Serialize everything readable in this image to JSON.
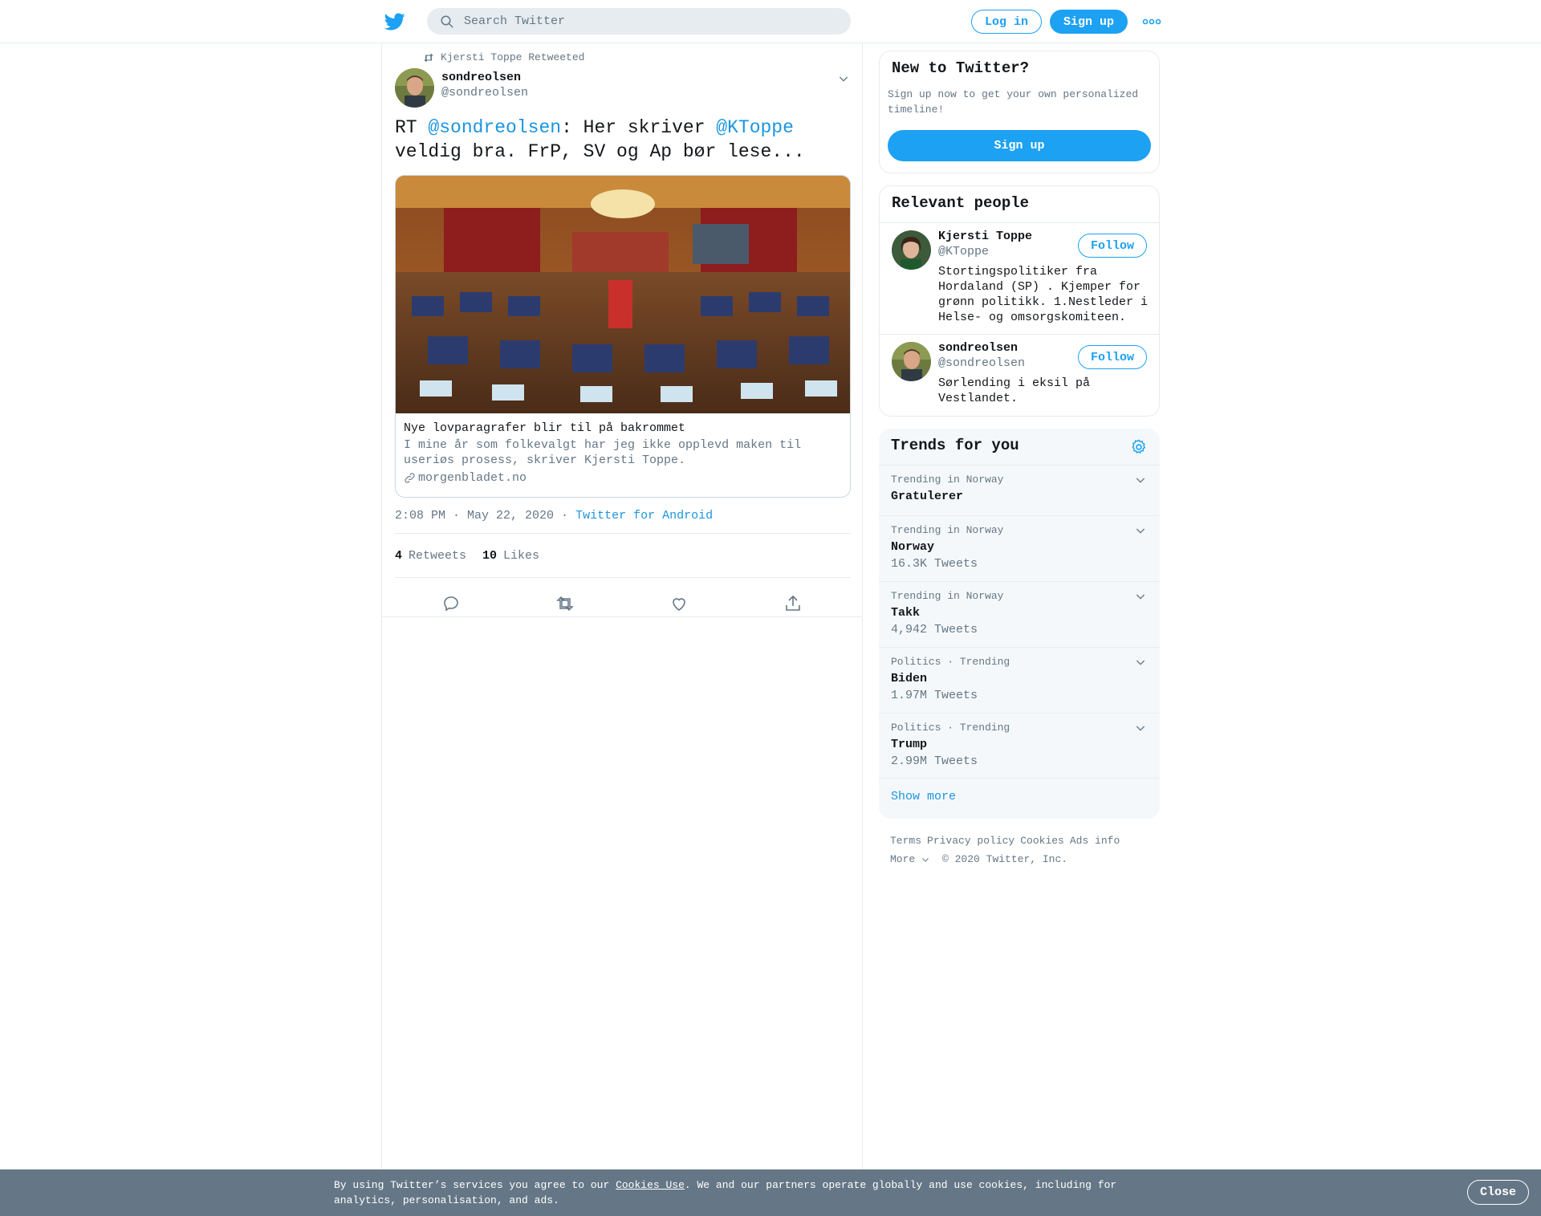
{
  "header": {
    "search_placeholder": "Search Twitter",
    "login_label": "Log in",
    "signup_label": "Sign up"
  },
  "tweet": {
    "retweeted_by": "Kjersti Toppe Retweeted",
    "author_name": "sondreolsen",
    "author_handle": "@sondreolsen",
    "text_prefix": "RT ",
    "mention1": "@sondreolsen",
    "text_mid": ": Her skriver ",
    "mention2": "@KToppe",
    "text_suffix": " veldig bra. FrP, SV og Ap bør lese...",
    "card": {
      "title": "Nye lovparagrafer blir til på bakrommet",
      "description": "I mine år som folkevalgt har jeg ikke opplevd maken til useriøs prosess, skriver Kjersti Toppe.",
      "domain": "morgenbladet.no"
    },
    "time": "2:08 PM · May 22, 2020",
    "separator": " · ",
    "source": "Twitter for Android",
    "retweets_count": "4",
    "retweets_label": "Retweets",
    "likes_count": "10",
    "likes_label": "Likes"
  },
  "sidebar": {
    "new_title": "New to Twitter?",
    "new_desc": "Sign up now to get your own personalized timeline!",
    "new_signup": "Sign up",
    "people_title": "Relevant people",
    "people": [
      {
        "name": "Kjersti Toppe",
        "handle": "@KToppe",
        "bio": "Stortingspolitiker fra Hordaland (SP) . Kjemper for grønn politikk. 1.Nestleder i Helse- og omsorgskomiteen.",
        "follow": "Follow"
      },
      {
        "name": "sondreolsen",
        "handle": "@sondreolsen",
        "bio": "Sørlending i eksil på Vestlandet.",
        "follow": "Follow"
      }
    ],
    "trends_title": "Trends for you",
    "trends": [
      {
        "context": "Trending in Norway",
        "name": "Gratulerer",
        "count": ""
      },
      {
        "context": "Trending in Norway",
        "name": "Norway",
        "count": "16.3K Tweets"
      },
      {
        "context": "Trending in Norway",
        "name": "Takk",
        "count": "4,942 Tweets"
      },
      {
        "context": "Politics · Trending",
        "name": "Biden",
        "count": "1.97M Tweets"
      },
      {
        "context": "Politics · Trending",
        "name": "Trump",
        "count": "2.99M Tweets"
      }
    ],
    "show_more": "Show more"
  },
  "footer": {
    "links": [
      "Terms",
      "Privacy policy",
      "Cookies",
      "Ads info"
    ],
    "more": "More",
    "copyright": "© 2020 Twitter, Inc."
  },
  "cookie": {
    "text_before": "By using Twitter’s services you agree to our ",
    "link": "Cookies Use",
    "text_after": ". We and our partners operate globally and use cookies, including for analytics, personalisation, and ads.",
    "close": "Close"
  },
  "colors": {
    "accent": "#1da1f2",
    "link": "#1b95e0",
    "muted": "#657786",
    "cookie_bar": "#657786"
  },
  "icons": [
    "twitter-bird-icon",
    "search-icon",
    "more-dots-icon",
    "retweet-icon",
    "chevron-down-icon",
    "link-icon",
    "reply-icon",
    "like-icon",
    "share-icon",
    "gear-icon"
  ]
}
